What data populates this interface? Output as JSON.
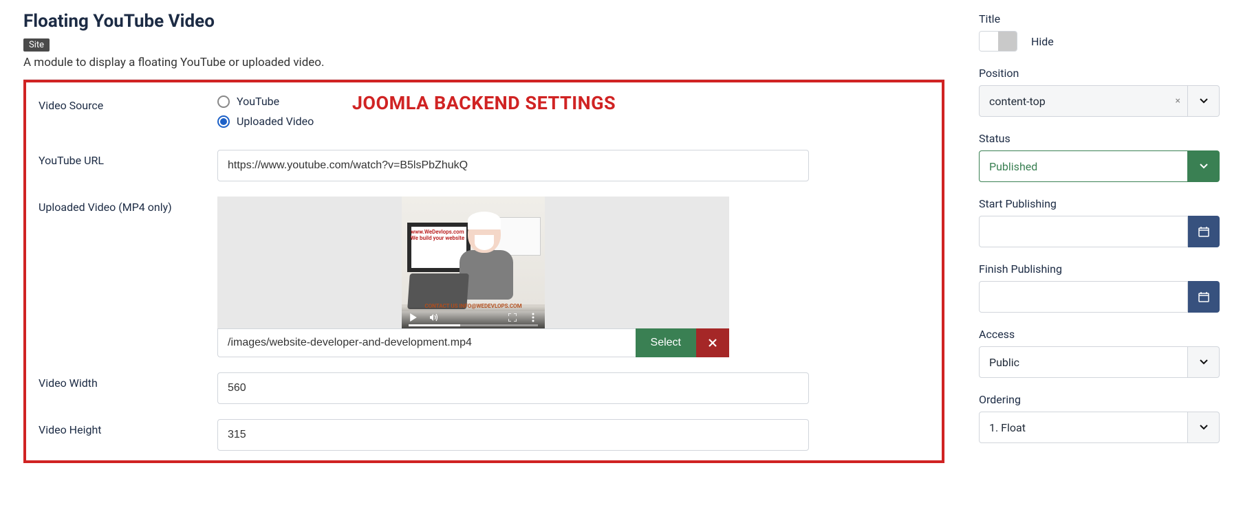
{
  "header": {
    "title": "Floating YouTube Video",
    "badge": "Site",
    "desc": "A module to display a floating YouTube or uploaded video."
  },
  "overlay": "JOOMLA BACKEND SETTINGS",
  "form": {
    "video_source": {
      "label": "Video Source",
      "opt_youtube": "YouTube",
      "opt_uploaded": "Uploaded Video"
    },
    "youtube_url": {
      "label": "YouTube URL",
      "value": "https://www.youtube.com/watch?v=B5lsPbZhukQ"
    },
    "uploaded": {
      "label": "Uploaded Video (MP4 only)",
      "path": "/images/website-developer-and-development.mp4",
      "select_btn": "Select",
      "poster_text": "www.WeDevlops.com We build your website",
      "contact": "CONTACT US INFO@WEDEVLOPS.COM"
    },
    "width": {
      "label": "Video Width",
      "value": "560"
    },
    "height": {
      "label": "Video Height",
      "value": "315"
    }
  },
  "side": {
    "title": {
      "label": "Title",
      "toggle_text": "Hide"
    },
    "position": {
      "label": "Position",
      "value": "content-top"
    },
    "status": {
      "label": "Status",
      "value": "Published"
    },
    "start": {
      "label": "Start Publishing",
      "value": ""
    },
    "finish": {
      "label": "Finish Publishing",
      "value": ""
    },
    "access": {
      "label": "Access",
      "value": "Public"
    },
    "ordering": {
      "label": "Ordering",
      "value": "1. Float"
    }
  }
}
